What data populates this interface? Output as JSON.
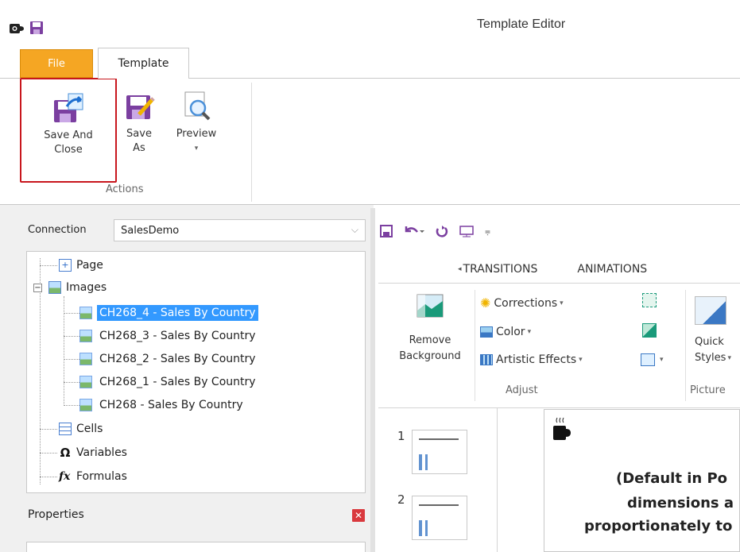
{
  "window": {
    "title": "Template Editor"
  },
  "tabs": {
    "file": "File",
    "template": "Template"
  },
  "ribbon": {
    "save_and_close_line1": "Save And",
    "save_and_close_line2": "Close",
    "save_as_line1": "Save",
    "save_as_line2": "As",
    "preview": "Preview",
    "preview_arrow": "▾",
    "group_actions": "Actions"
  },
  "connection": {
    "label": "Connection",
    "value": "SalesDemo"
  },
  "tree": {
    "page": "Page",
    "images": "Images",
    "image_items": [
      "CH268_4 - Sales By Country",
      "CH268_3 - Sales By Country",
      "CH268_2 - Sales By Country",
      "CH268_1 - Sales By Country",
      "CH268 - Sales By Country"
    ],
    "cells": "Cells",
    "variables": "Variables",
    "formulas": "Formulas",
    "expander": "−"
  },
  "properties": {
    "label": "Properties"
  },
  "ppt": {
    "tab_transitions": "TRANSITIONS",
    "tab_animations": "ANIMATIONS",
    "remove_background_line1": "Remove",
    "remove_background_line2": "Background",
    "corrections": "Corrections",
    "color": "Color",
    "artistic_effects": "Artistic Effects",
    "dropdown_arrow": "▾",
    "quick_line1": "Quick",
    "quick_line2": "Styles",
    "group_adjust": "Adjust",
    "group_picture": "Picture",
    "slide_nums": [
      "1",
      "2"
    ],
    "slide_text": [
      "(Default in Po",
      "dimensions a",
      "proportionately to"
    ]
  },
  "colors": {
    "file_tab": "#f5a623",
    "highlight_border": "#c8161d",
    "selection": "#3399ff"
  }
}
